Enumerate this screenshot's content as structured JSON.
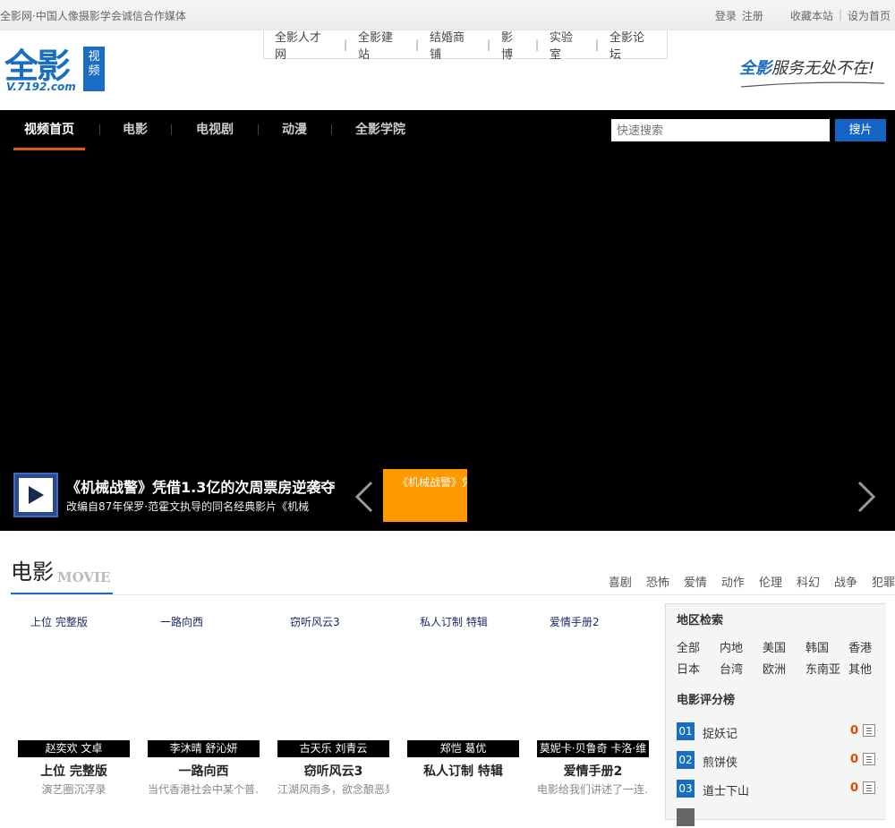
{
  "topbar": {
    "tagline": "全影网·中国人像摄影学会诚信合作媒体",
    "login": "登录",
    "register": "注册",
    "bookmark": "收藏本站",
    "sep": "|",
    "homepage": "设为首页"
  },
  "header": {
    "logo_main": "全影",
    "logo_site": "V.7192.com",
    "logo_badge": "视频",
    "site_nav": [
      "全影人才网",
      "全影建站",
      "结婚商铺",
      "影博",
      "实验室",
      "全影论坛"
    ],
    "slogan_brand": "全影",
    "slogan_text": "服务无处不在!"
  },
  "nav": {
    "items": [
      "视频首页",
      "电影",
      "电视剧",
      "动漫",
      "全影学院"
    ],
    "search_placeholder": "快速搜索",
    "search_button": "搜片"
  },
  "feature": {
    "title": "《机械战警》凭借1.3亿的次周票房逆袭夺",
    "desc": "改编自87年保罗·范霍文执导的同名经典影片《机械",
    "active_thumb": "《机械战警》凭",
    "prev": "‹",
    "next": "›"
  },
  "movie_section": {
    "title": "电影",
    "title_en": "MOVIE",
    "genres": [
      "喜剧",
      "恐怖",
      "爱情",
      "动作",
      "伦理",
      "科幻",
      "战争",
      "犯罪"
    ],
    "cards": [
      {
        "top": "上位 完整版",
        "cast": "赵奕欢 文卓",
        "name": "上位 完整版",
        "desc": "演艺圈沉浮录"
      },
      {
        "top": "一路向西",
        "cast": "李沐晴 舒沁妍",
        "name": "一路向西",
        "desc": "当代香港社会中某个普..."
      },
      {
        "top": "窃听风云3",
        "cast": "古天乐 刘青云",
        "name": "窃听风云3",
        "desc": "江湖风雨多，欲念酿恶果"
      },
      {
        "top": "私人订制 特辑",
        "cast": "郑恺 葛优",
        "name": "私人订制 特辑",
        "desc": ""
      },
      {
        "top": "爱情手册2",
        "cast": "莫妮卡·贝鲁奇 卡洛·维",
        "name": "爱情手册2",
        "desc": "电影给我们讲述了一连..."
      }
    ]
  },
  "sidebar": {
    "region_title": "地区检索",
    "regions": [
      "全部",
      "内地",
      "美国",
      "韩国",
      "香港",
      "日本",
      "台湾",
      "欧洲",
      "东南亚",
      "其他"
    ],
    "rank_title": "电影评分榜",
    "rankings": [
      {
        "num": "01",
        "title": "捉妖记",
        "score": "0"
      },
      {
        "num": "02",
        "title": "煎饼侠",
        "score": "0"
      },
      {
        "num": "03",
        "title": "道士下山",
        "score": "0"
      }
    ]
  },
  "colors": {
    "brand_blue": "#1a6ec2",
    "nav_bg": "#000000",
    "active_underline": "#e05a1a",
    "thumb_active": "#ff9900",
    "search_button": "#1464c8"
  }
}
